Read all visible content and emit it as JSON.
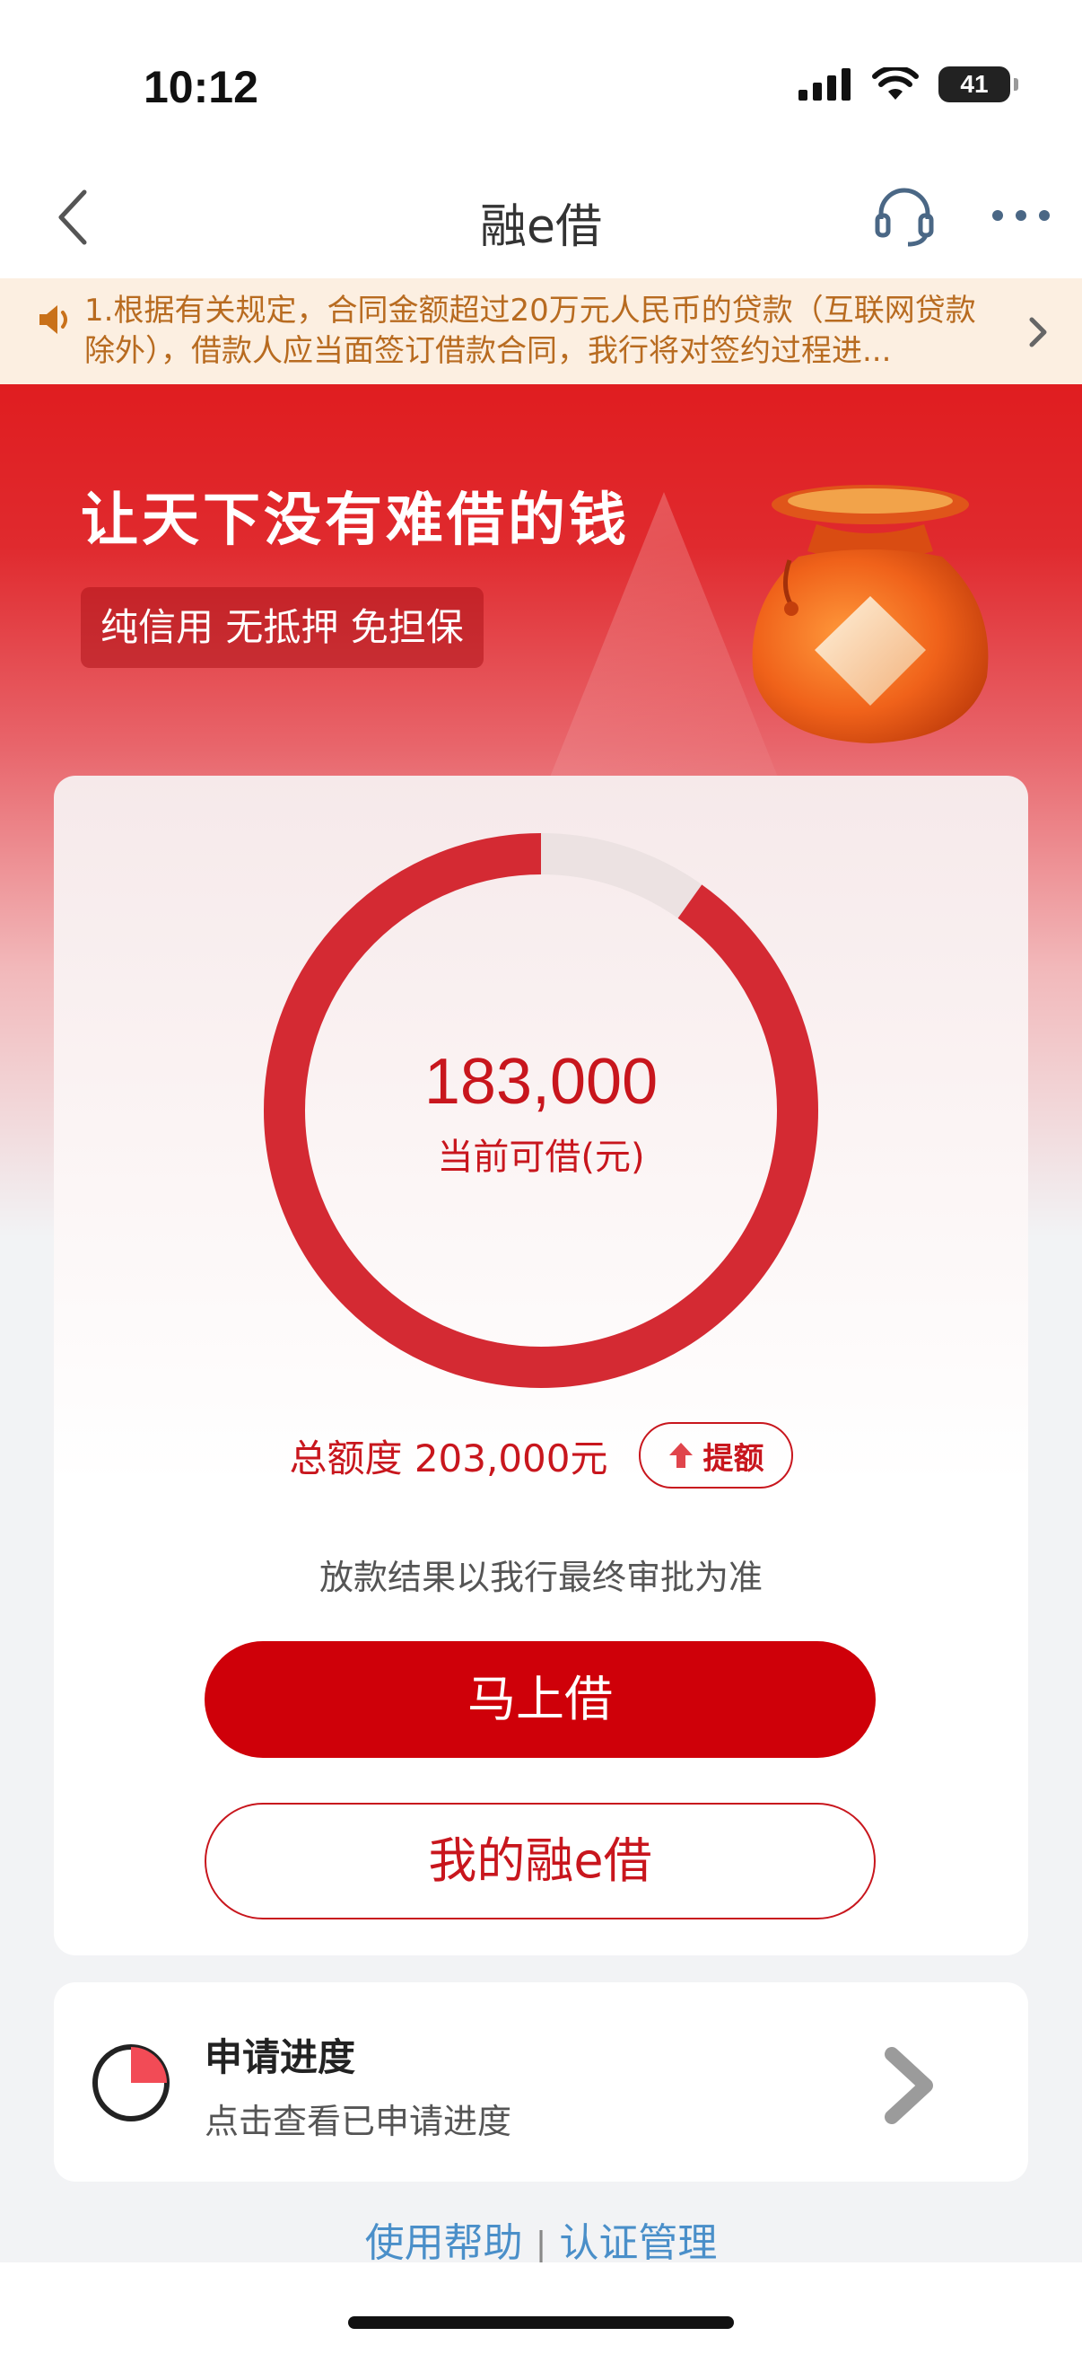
{
  "status_bar": {
    "time": "10:12",
    "battery": "41"
  },
  "nav": {
    "title": "融e借"
  },
  "notice": {
    "text": "1.根据有关规定，合同金额超过20万元人民币的贷款（互联网贷款除外），借款人应当面签订借款合同，我行将对签约过程进..."
  },
  "hero": {
    "title": "让天下没有难借的钱",
    "tag": "纯信用 无抵押 免担保"
  },
  "credit": {
    "available_amount": "183,000",
    "available_label": "当前可借(元)",
    "total_label": "总额度 203,000元",
    "raise_label": "提额",
    "disclaimer": "放款结果以我行最终审批为准",
    "available_fraction": 0.9015
  },
  "actions": {
    "borrow_label": "马上借",
    "my_loans_label": "我的融e借"
  },
  "progress": {
    "title": "申请进度",
    "subtitle": "点击查看已申请进度"
  },
  "footer": {
    "help_label": "使用帮助",
    "separator": "|",
    "auth_label": "认证管理"
  },
  "colors": {
    "brand_red": "#cf0009",
    "text_red": "#c8161d",
    "notice_bg": "#fcefe1",
    "notice_text": "#b86b20",
    "link_blue": "#4a8fc9"
  },
  "icons": {
    "back": "chevron-left-icon",
    "service": "headset-icon",
    "more": "more-dots-icon",
    "notice": "speaker-icon",
    "notice_arrow": "chevron-right-icon",
    "bag": "money-bag-icon",
    "raise": "arrow-up-icon",
    "progress": "pie-progress-icon",
    "progress_arrow": "chevron-right-icon"
  }
}
